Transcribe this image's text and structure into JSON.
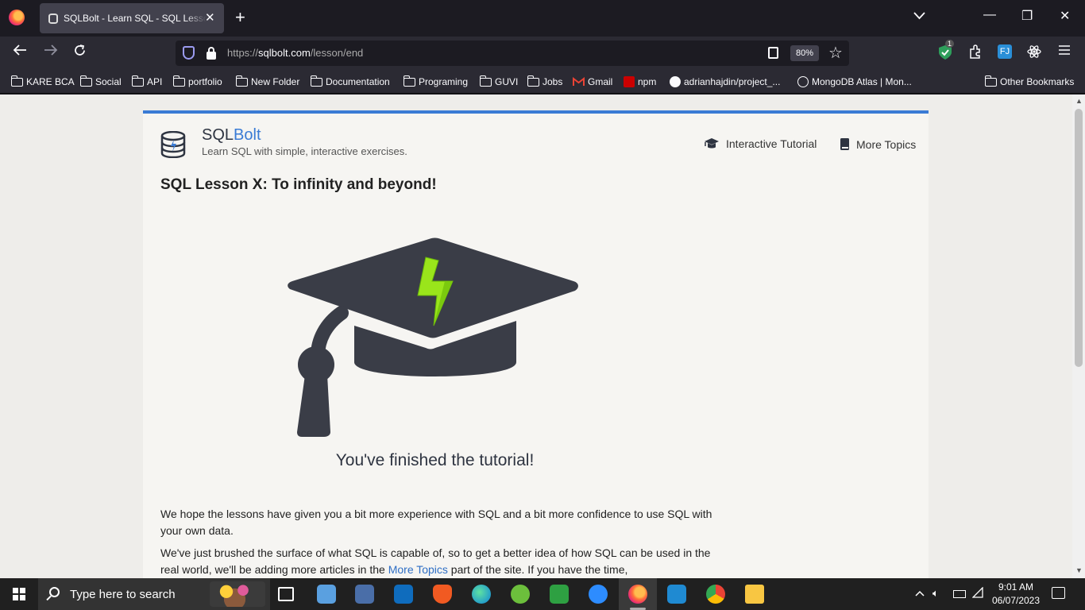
{
  "browser": {
    "tab_title": "SQLBolt - Learn SQL - SQL Lesson X: To infinity and beyond!",
    "tab_close": "✕",
    "new_tab": "+",
    "url_scheme": "https://",
    "url_host": "sqlbolt.com",
    "url_path": "/lesson/end",
    "zoom": "80%",
    "extension_badge": "1",
    "minimize": "—",
    "restore": "❐",
    "close": "✕"
  },
  "bookmarks": {
    "items": [
      {
        "label": "KARE BCA",
        "icon": "folder"
      },
      {
        "label": "Social",
        "icon": "folder"
      },
      {
        "label": "API",
        "icon": "folder"
      },
      {
        "label": "portfolio",
        "icon": "folder"
      },
      {
        "label": "New Folder",
        "icon": "folder"
      },
      {
        "label": "Documentation",
        "icon": "folder"
      },
      {
        "label": "Programing",
        "icon": "folder"
      },
      {
        "label": "GUVI",
        "icon": "folder"
      },
      {
        "label": "Jobs",
        "icon": "folder"
      },
      {
        "label": "Gmail",
        "icon": "gmail-icon"
      },
      {
        "label": "npm",
        "icon": "npm-icon"
      },
      {
        "label": "adrianhajdin/project_...",
        "icon": "github-icon"
      },
      {
        "label": "MongoDB Atlas | Mon...",
        "icon": "globe-icon"
      }
    ],
    "other": "Other Bookmarks"
  },
  "page": {
    "brand_sql": "SQL",
    "brand_bolt": "Bolt",
    "tagline": "Learn SQL with simple, interactive exercises.",
    "nav_tutorial": "Interactive Tutorial",
    "nav_topics": "More Topics",
    "lesson_title": "SQL Lesson X: To infinity and beyond!",
    "finished": "You've finished the tutorial!",
    "para1": "We hope the lessons have given you a bit more experience with SQL and a bit more confidence to use SQL with your own data.",
    "para2_before": "We've just brushed the surface of what SQL is capable of, so to get a better idea of how SQL can be used in the real world, we'll be adding more articles in the ",
    "para2_link": "More Topics",
    "para2_after": " part of the site. If you have the time,"
  },
  "taskbar": {
    "search_placeholder": "Type here to search",
    "time": "9:01 AM",
    "date": "06/07/2023"
  },
  "colors": {
    "accent": "#3a7bd5",
    "cap": "#3a3d47",
    "bolt": "#9ae51b"
  }
}
